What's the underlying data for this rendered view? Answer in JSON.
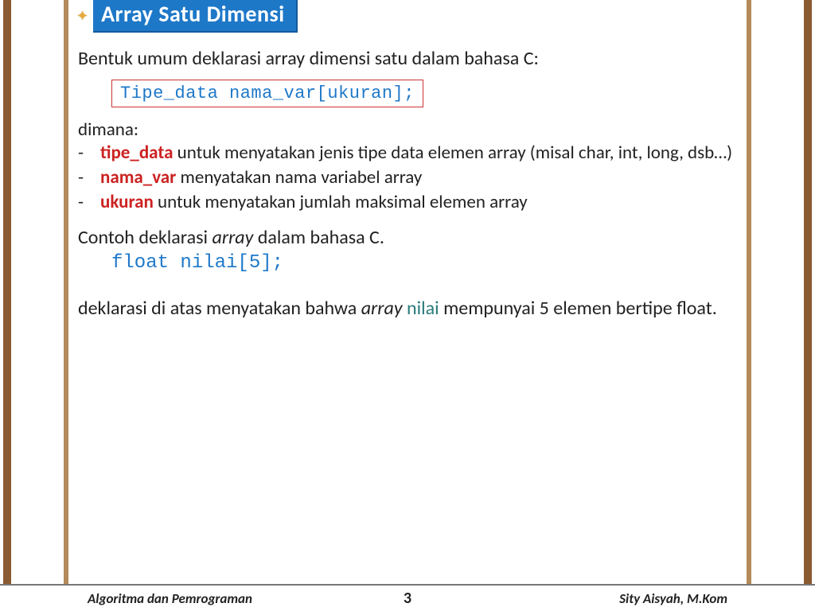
{
  "title": "Array Satu Dimensi",
  "intro": "Bentuk umum deklarasi array  dimensi satu dalam bahasa C:",
  "codebox": "Tipe_data  nama_var[ukuran];",
  "where": "dimana:",
  "bullets": [
    {
      "kw": "tipe_data",
      "rest": " untuk menyatakan jenis tipe data elemen array (misal char, int, long, dsb…)"
    },
    {
      "kw": "nama_var",
      "rest": " menyatakan nama variabel array"
    },
    {
      "kw": "ukuran",
      "rest": " untuk menyatakan jumlah maksimal elemen array"
    }
  ],
  "contoh_pre": "Contoh deklarasi ",
  "contoh_it": "array",
  "contoh_post": " dalam bahasa C.",
  "code_line": "float nilai[5];",
  "explain_pre": "deklarasi di atas menyatakan bahwa ",
  "explain_it": "array",
  "explain_teal": " nilai",
  "explain_post": " mempunyai 5 elemen bertipe float.",
  "footer": {
    "left": "Algoritma dan Pemrograman",
    "page": "3",
    "right": "Sity Aisyah, M.Kom"
  }
}
